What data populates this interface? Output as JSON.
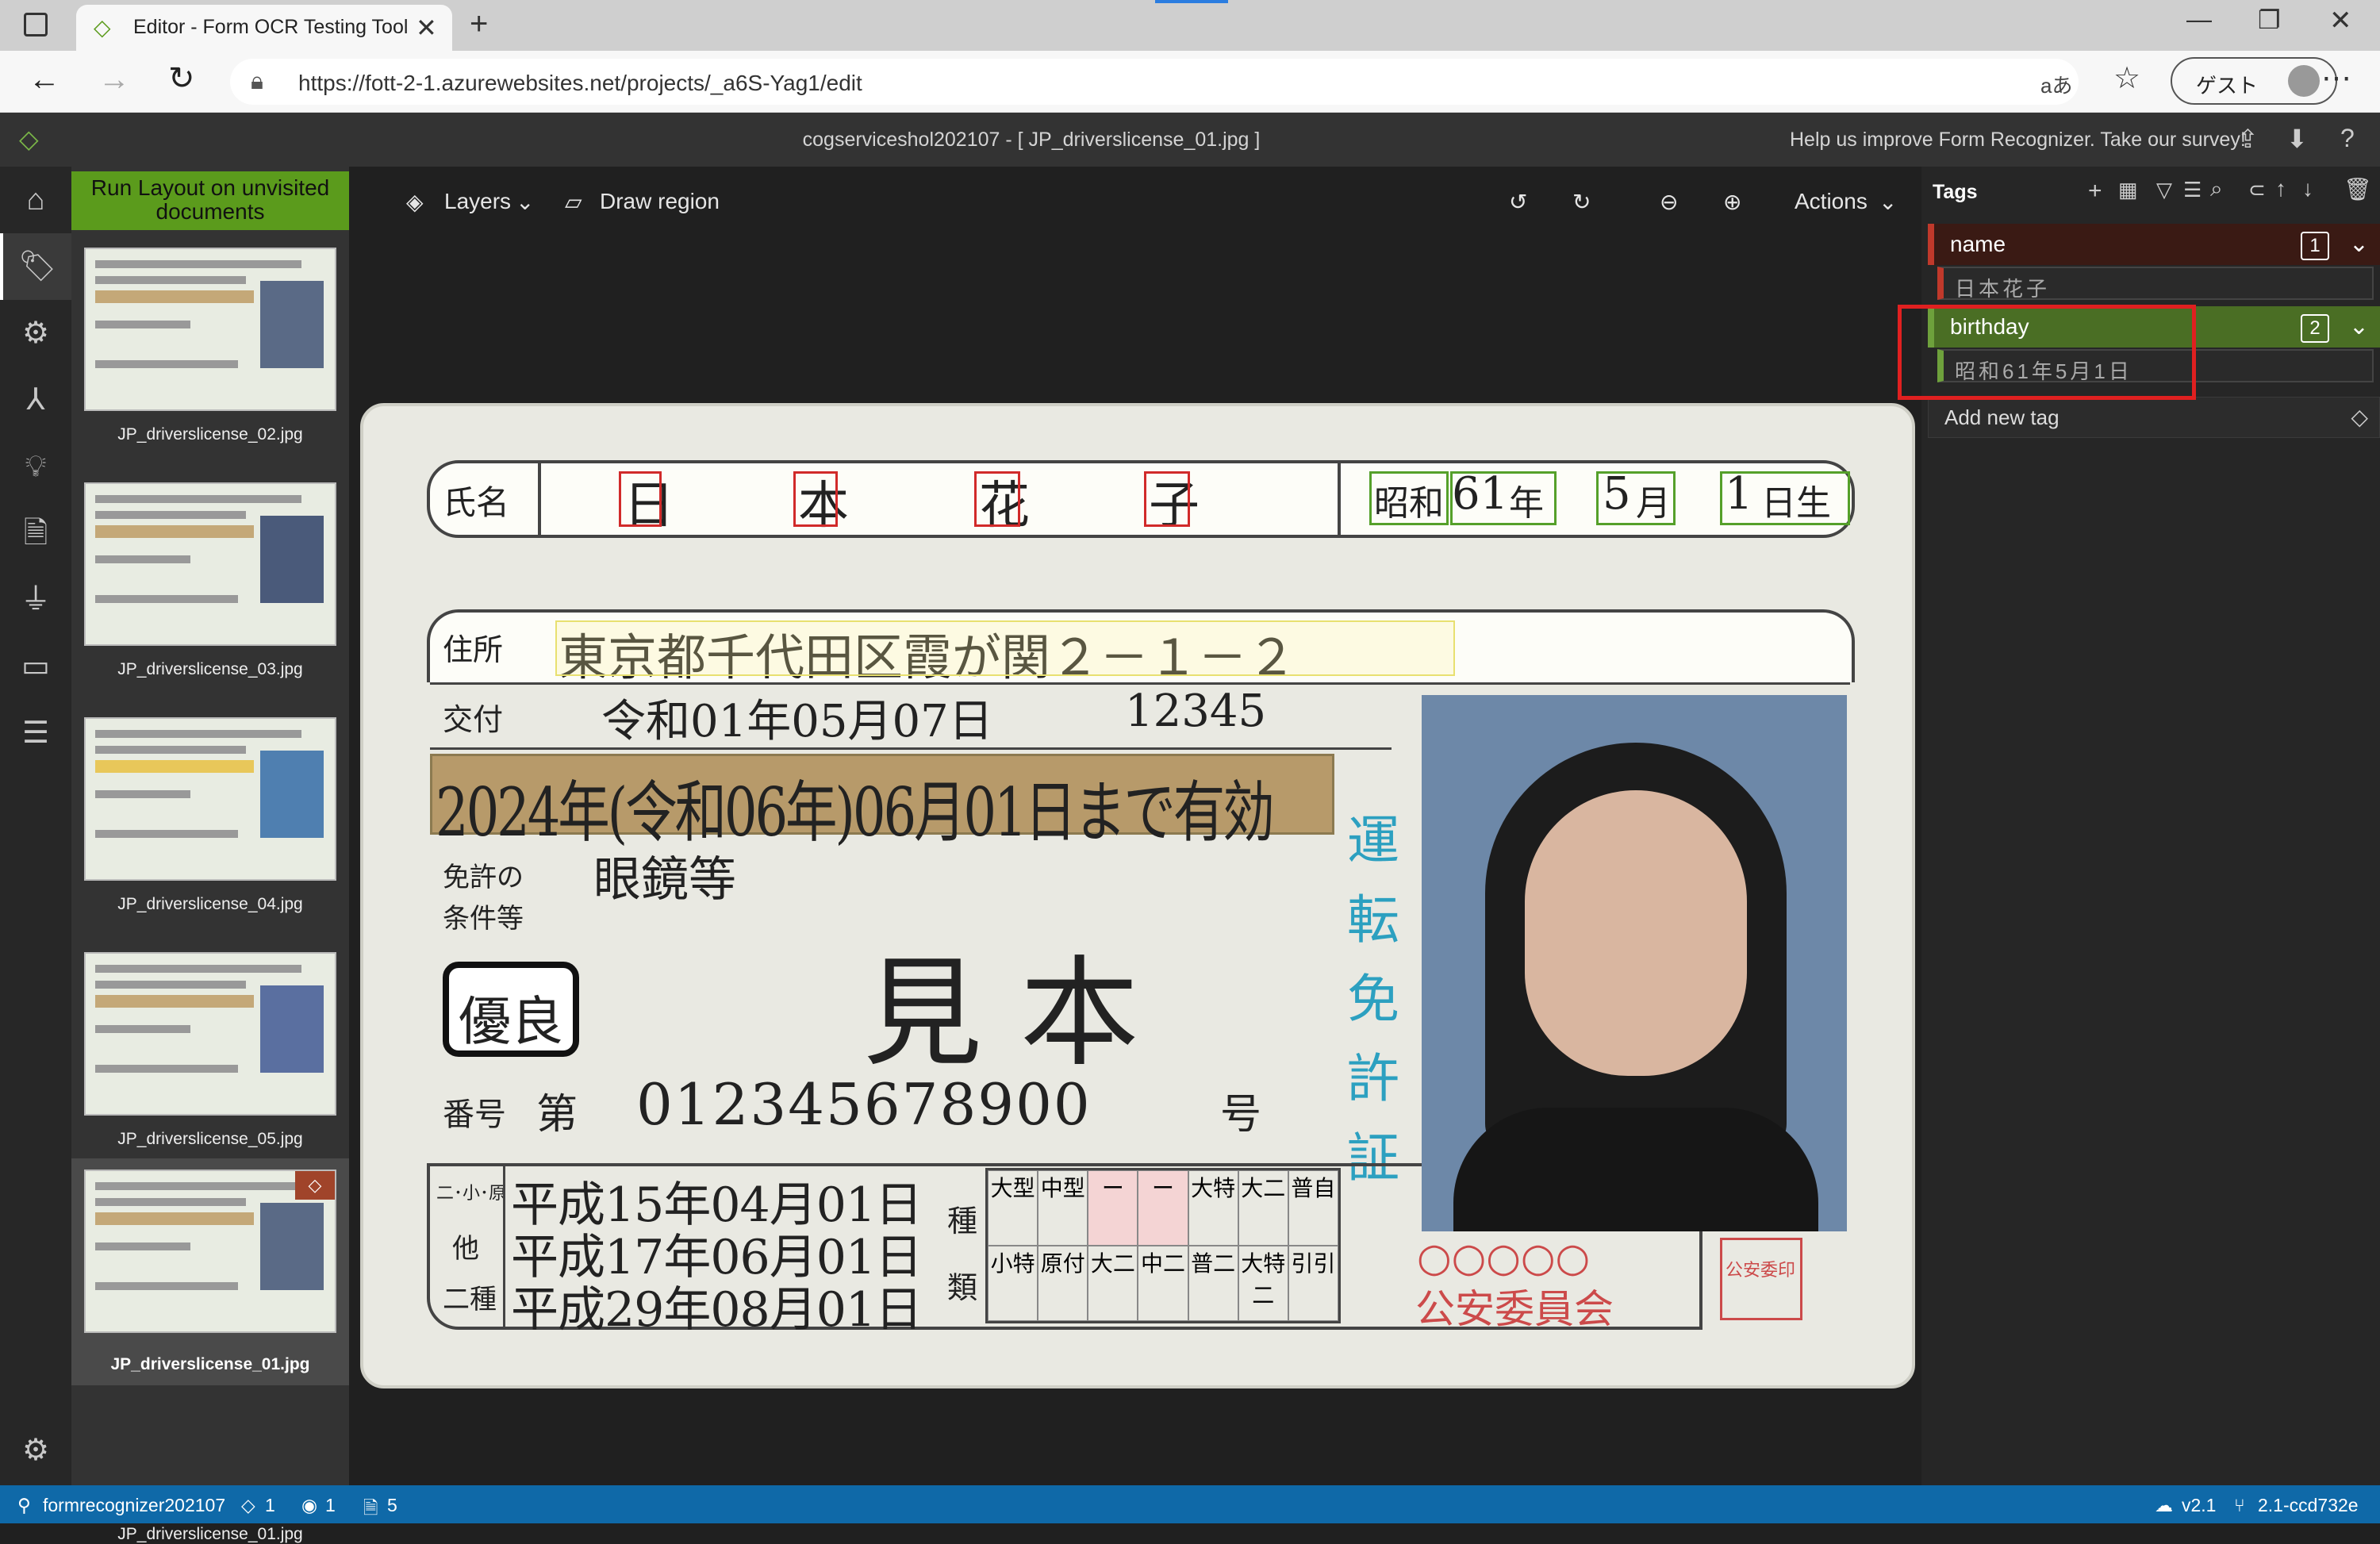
{
  "browser": {
    "tab_title": "Editor - Form OCR Testing Tool",
    "url": "https://fott-2-1.azurewebsites.net/projects/_a6S-Yag1/edit",
    "reader_label": "aあ",
    "guest_label": "ゲスト"
  },
  "app": {
    "header_title": "cogserviceshol202107 - [ JP_driverslicense_01.jpg ]",
    "survey_text": "Help us improve Form Recognizer. Take our survey!"
  },
  "left_nav": {
    "items": [
      "home-icon",
      "tag-icon",
      "robot-icon",
      "merge-icon",
      "lightbulb-icon",
      "document-settings-icon",
      "plug-icon",
      "id-card-icon",
      "document-list-icon",
      "settings-icon"
    ]
  },
  "thumbnails": {
    "run_label": "Run Layout on unvisited documents",
    "items": [
      {
        "name": "JP_driverslicense_02.jpg",
        "active": false
      },
      {
        "name": "JP_driverslicense_03.jpg",
        "active": false
      },
      {
        "name": "JP_driverslicense_04.jpg",
        "active": false
      },
      {
        "name": "JP_driverslicense_05.jpg",
        "active": false
      },
      {
        "name": "JP_driverslicense_01.jpg",
        "active": true
      }
    ]
  },
  "toolbar": {
    "layers_label": "Layers",
    "draw_region_label": "Draw region",
    "actions_label": "Actions"
  },
  "license": {
    "name_label": "氏名",
    "name_chars": [
      "日",
      "本",
      "花",
      "子"
    ],
    "birth_era": "昭和",
    "birth_year": "61",
    "birth_year_unit": "年",
    "birth_month": "5",
    "birth_month_unit": "月",
    "birth_day": "1",
    "birth_day_unit": "日生",
    "address_label": "住所",
    "address": "東京都千代田区霞が関２－１－２",
    "issue_label": "交付",
    "issue_date": "令和01年05月07日",
    "issue_no": "12345",
    "expiry": "2024年(令和06年)06月01日まで有効",
    "conditions_label_1": "免許の",
    "conditions_label_2": "条件等",
    "conditions": "眼鏡等",
    "sample": "見 本",
    "excellent": "優良",
    "number_label": "番号",
    "number_prefix": "第",
    "number": "012345678900",
    "number_suffix": "号",
    "vertical": [
      "運",
      "転",
      "免",
      "許",
      "証"
    ],
    "date_rows": [
      {
        "label": "二･小･原",
        "date": "平成15年04月01日"
      },
      {
        "label": "他",
        "date": "平成17年06月01日"
      },
      {
        "label": "二種",
        "date": "平成29年08月01日"
      }
    ],
    "grid_label_1": "種",
    "grid_label_2": "類",
    "grid_top": [
      "大型",
      "中型",
      "ー",
      "ー",
      "大特",
      "大二",
      "普自"
    ],
    "grid_bottom": [
      "小特",
      "原付",
      "大二",
      "中二",
      "普二",
      "大特二",
      "引引"
    ],
    "circles": "○○○○○",
    "commission": "公安委員会",
    "seal": "公安委印"
  },
  "tags": {
    "header": "Tags",
    "items": [
      {
        "name": "name",
        "number": "1",
        "value": "日本花子",
        "color": "#c0392b"
      },
      {
        "name": "birthday",
        "number": "2",
        "value": "昭和61年5月1日",
        "color": "#6ea13c"
      }
    ],
    "add_label": "Add new tag"
  },
  "status": {
    "project": "formrecognizer202107",
    "tag_count": "1",
    "visited_count": "1",
    "doc_count": "5",
    "version": "v2.1",
    "commit": "2.1-ccd732e"
  }
}
